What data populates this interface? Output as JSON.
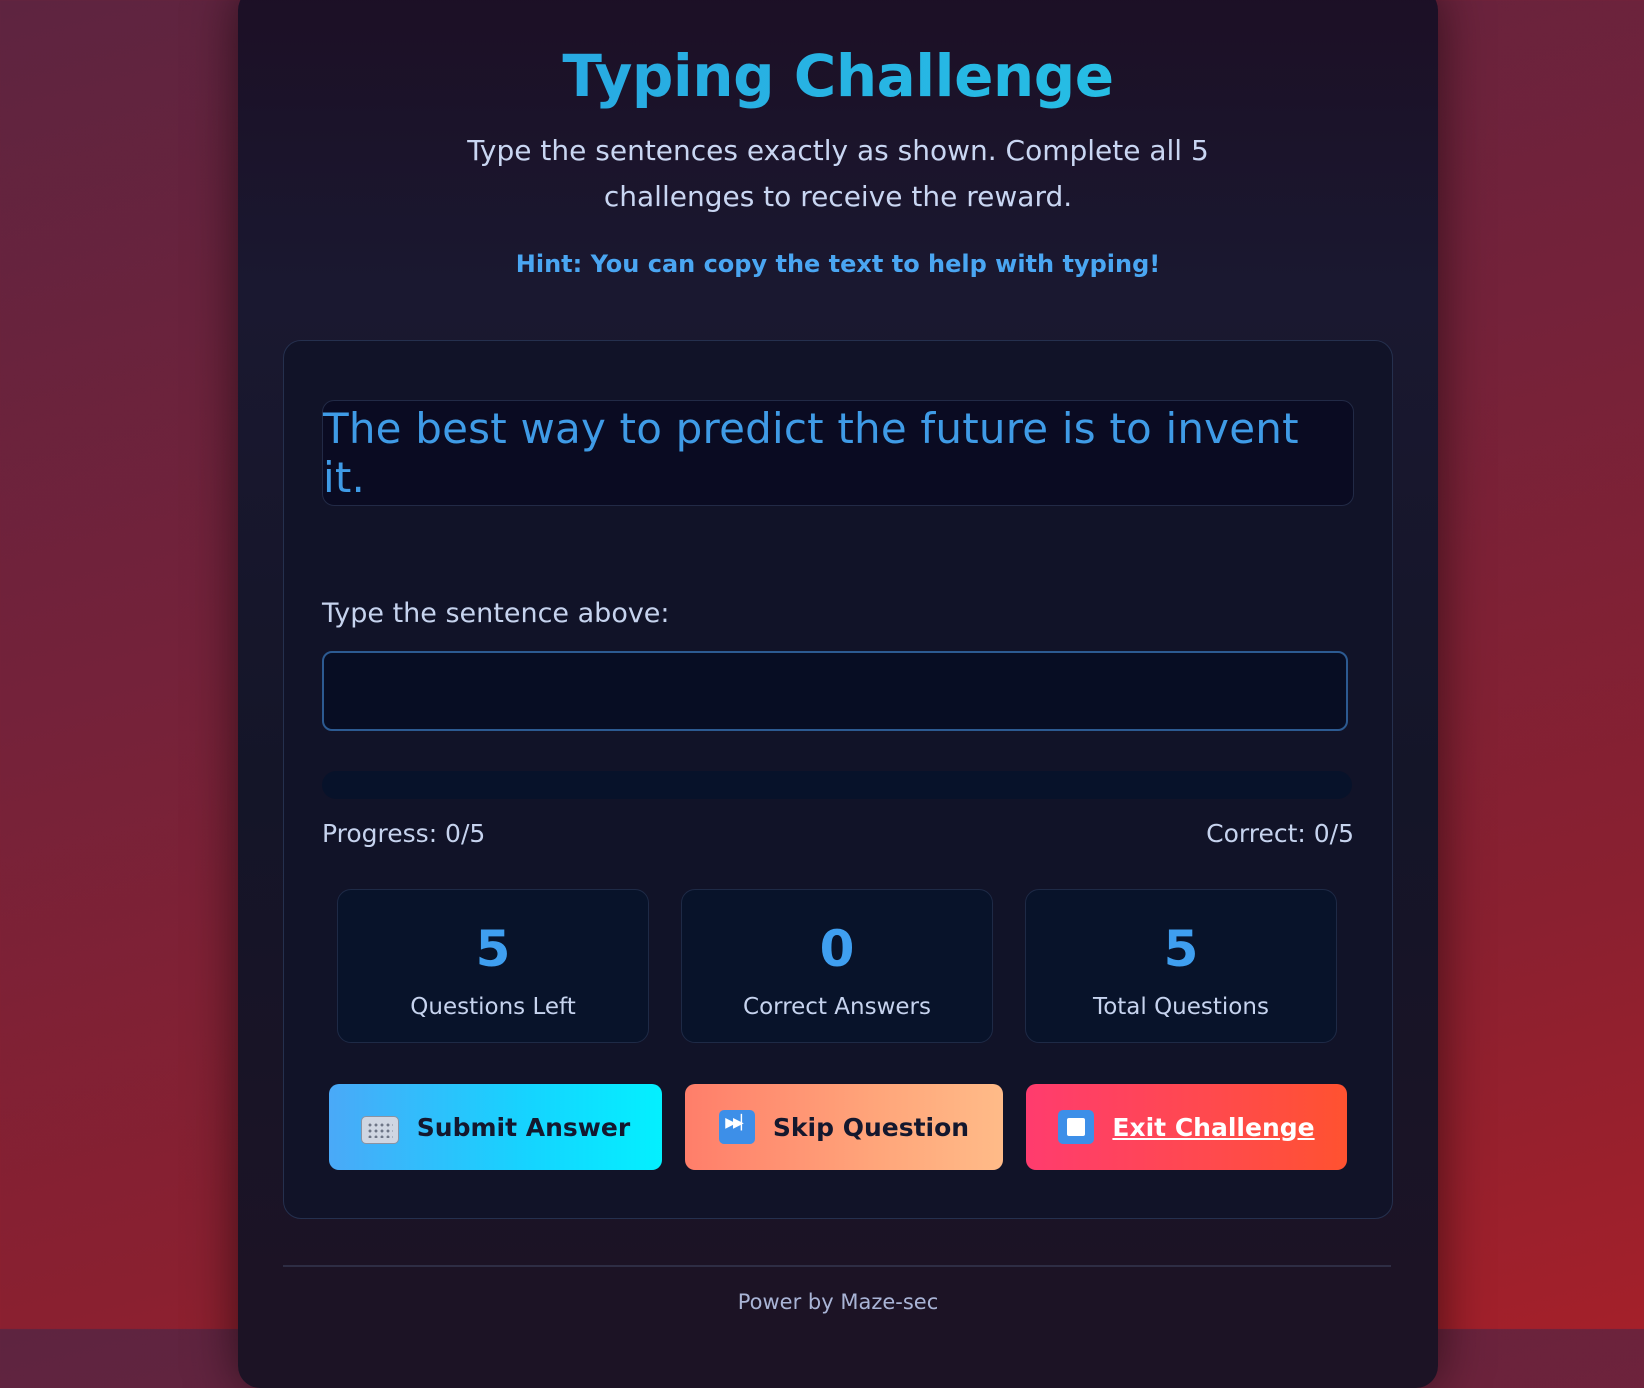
{
  "header": {
    "title": "Typing Challenge",
    "subtitle": "Type the sentences exactly as shown. Complete all 5 challenges to receive the reward.",
    "hint": "Hint: You can copy the text to help with typing!"
  },
  "challenge": {
    "sentence": "The best way to predict the future is to invent it.",
    "input_label": "Type the sentence above:",
    "input_value": "",
    "input_placeholder": ""
  },
  "progress": {
    "fraction": 0,
    "progress_text": "Progress: 0/5",
    "correct_text": "Correct: 0/5"
  },
  "stats": [
    {
      "value": "5",
      "label": "Questions Left"
    },
    {
      "value": "0",
      "label": "Correct Answers"
    },
    {
      "value": "5",
      "label": "Total Questions"
    }
  ],
  "buttons": {
    "submit": {
      "label": "Submit Answer",
      "icon": "keyboard-icon"
    },
    "skip": {
      "label": "Skip Question",
      "icon": "next-track-icon"
    },
    "exit": {
      "label": "Exit Challenge",
      "icon": "stop-icon"
    }
  },
  "footer": {
    "text": "Power by Maze-sec"
  },
  "colors": {
    "accent": "#3f9ff0",
    "submit_gradient": [
      "#4aa9f8",
      "#03f0ff"
    ],
    "skip_gradient": [
      "#ff7e6a",
      "#ffbb88"
    ],
    "exit_gradient": [
      "#ff3c6e",
      "#ff5230"
    ]
  }
}
